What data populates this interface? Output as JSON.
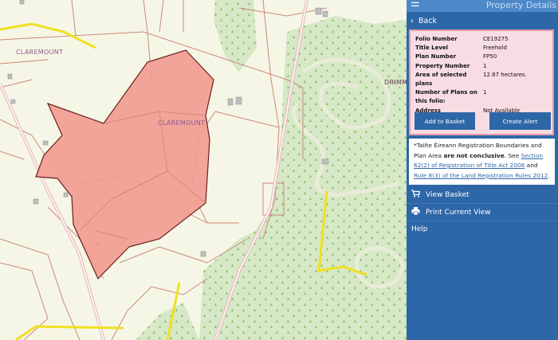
{
  "panel": {
    "title": "Property Details",
    "back_label": "Back",
    "details": [
      {
        "label": "Folio Number",
        "value": "CE19275"
      },
      {
        "label": "Title Level",
        "value": "Freehold"
      },
      {
        "label": "Plan Number",
        "value": "FP50"
      },
      {
        "label": "Property Number",
        "value": "1"
      },
      {
        "label": "Area of selected plans",
        "value": "12.87 hectares."
      },
      {
        "label": "Number of Plans on this folio:",
        "value": "1"
      },
      {
        "label": "Address",
        "value": "Not Available"
      }
    ],
    "add_to_basket_label": "Add to Basket",
    "create_alert_label": "Create Alert",
    "notice": {
      "prefix": "*Tailte Éireann Registration Boundaries and Plan Area ",
      "bold": "are not conclusive",
      "middle": ". See ",
      "link1": "Section 62(2) of Registration of Title Act 2006",
      "and": " and ",
      "link2": "Rule 8(3) of the Land Registration Rules 2012",
      "end": "."
    },
    "menu": {
      "view_basket": "View Basket",
      "print_view": "Print Current View",
      "help": "Help"
    },
    "icons": {
      "hamburger": "hamburger-icon",
      "back": "chevron-right-icon",
      "basket": "cart-icon",
      "print": "printer-icon",
      "help": "chevron-right-icon"
    }
  },
  "map": {
    "labels": {
      "townland_left": "CLAREMOUNT",
      "townland_parcel": "CLAREMOUNT",
      "townland_right": "DRIMM"
    },
    "colors": {
      "land": "#f6f6e6",
      "forest": "#d4e6c3",
      "parcel_fill": "#f29b90",
      "parcel_stroke": "#6a1f1f",
      "boundary": "#c98a7a",
      "road_yellow": "#f0e020",
      "townland_label": "#8e5a8e"
    }
  }
}
